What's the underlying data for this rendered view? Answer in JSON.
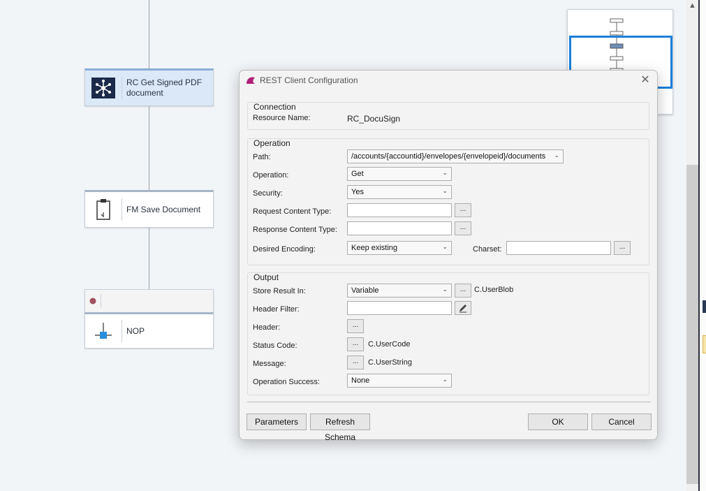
{
  "workflow": {
    "nodes": [
      {
        "label_line1": "RC Get Signed PDF",
        "label_line2": "document",
        "icon": "network-hub-icon"
      },
      {
        "label": "FM Save Document",
        "icon": "clipboard-icon"
      },
      {
        "label": "NOP",
        "icon": "nop-icon"
      }
    ]
  },
  "dialog": {
    "title": "REST Client Configuration",
    "connection": {
      "group_label": "Connection",
      "resource_name_label": "Resource Name:",
      "resource_name_value": "RC_DocuSign"
    },
    "operation": {
      "group_label": "Operation",
      "path_label": "Path:",
      "path_value": "/accounts/{accountid}/envelopes/{envelopeid}/documents",
      "operation_label": "Operation:",
      "operation_value": "Get",
      "security_label": "Security:",
      "security_value": "Yes",
      "request_content_type_label": "Request Content Type:",
      "response_content_type_label": "Response Content Type:",
      "desired_encoding_label": "Desired Encoding:",
      "desired_encoding_value": "Keep existing",
      "charset_label": "Charset:"
    },
    "output": {
      "group_label": "Output",
      "store_result_label": "Store Result In:",
      "store_result_value": "Variable",
      "store_result_variable": "C.UserBlob",
      "header_filter_label": "Header Filter:",
      "header_label": "Header:",
      "status_code_label": "Status Code:",
      "status_code_variable": "C.UserCode",
      "message_label": "Message:",
      "message_variable": "C.UserString",
      "operation_success_label": "Operation Success:",
      "operation_success_value": "None"
    },
    "ellipsis": "...",
    "buttons": {
      "parameters": "Parameters",
      "refresh_schema": "Refresh Schema",
      "ok": "OK",
      "cancel": "Cancel"
    }
  },
  "colors": {
    "accent": "#1e7fd9",
    "selected_node": "#dbe8f7",
    "logo": "#b0207a"
  }
}
